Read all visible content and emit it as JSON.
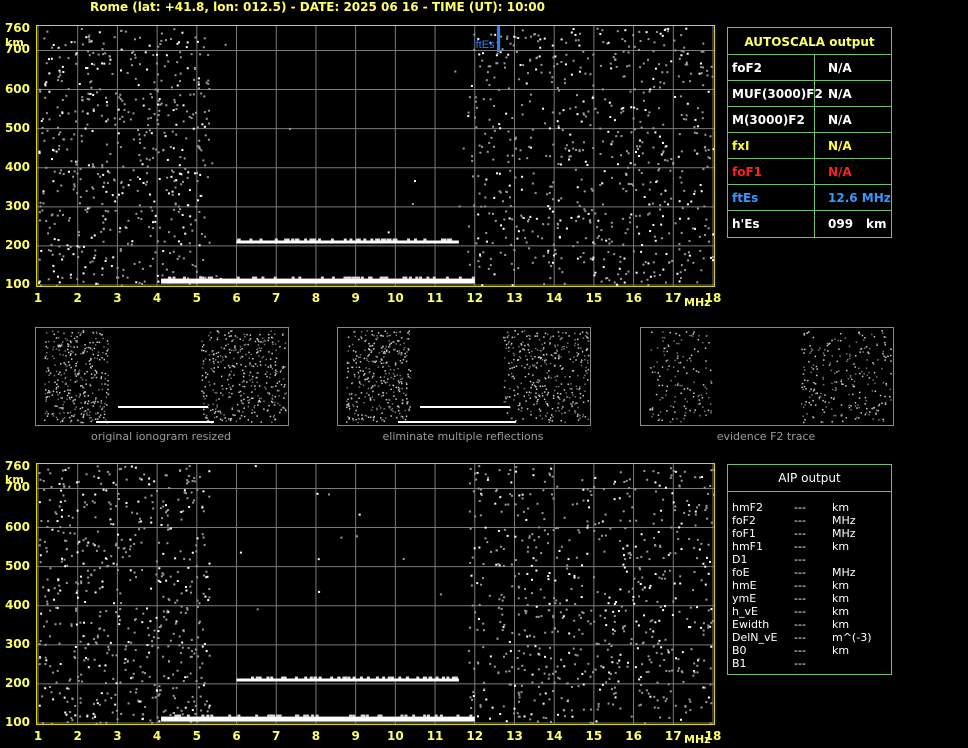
{
  "header": {
    "title": "Rome (lat: +41.8, lon: 012.5) - DATE: 2025 06 16 - TIME (UT): 10:00"
  },
  "axes": {
    "y_ticks": [
      "760",
      "700",
      "600",
      "500",
      "400",
      "300",
      "200",
      "100"
    ],
    "y_unit": "km",
    "x_ticks": [
      "1",
      "2",
      "3",
      "4",
      "5",
      "6",
      "7",
      "8",
      "9",
      "10",
      "11",
      "12",
      "13",
      "14",
      "15",
      "16",
      "17",
      "18"
    ],
    "x_unit": "MHz"
  },
  "plot_top": {
    "marker_label": "ftEs"
  },
  "chart_data": [
    {
      "type": "scatter",
      "name": "top-ionogram",
      "x_range": [
        1,
        18
      ],
      "y_range": [
        100,
        760
      ],
      "grid": true,
      "traces": [
        {
          "name": "E-layer trace",
          "x_start": 4.1,
          "x_end": 12.0,
          "y": 110
        },
        {
          "name": "Es-second-hop",
          "x_start": 6.0,
          "x_end": 11.6,
          "y": 210
        }
      ],
      "marker": {
        "label": "ftEs",
        "x": 12.6
      }
    },
    {
      "type": "scatter",
      "name": "bottom-ionogram",
      "x_range": [
        1,
        18
      ],
      "y_range": [
        100,
        760
      ],
      "grid": true,
      "traces": [
        {
          "name": "E-layer trace",
          "x_start": 4.1,
          "x_end": 12.0,
          "y": 110
        },
        {
          "name": "Es-second-hop",
          "x_start": 6.0,
          "x_end": 11.6,
          "y": 210
        }
      ]
    }
  ],
  "autoscala": {
    "title": "AUTOSCALA output",
    "rows": [
      {
        "key": "foF2",
        "value": "N/A",
        "color": "#ffffff"
      },
      {
        "key": "MUF(3000)F2",
        "value": "N/A",
        "color": "#ffffff"
      },
      {
        "key": "M(3000)F2",
        "value": "N/A",
        "color": "#ffffff"
      },
      {
        "key": "fxI",
        "value": "N/A",
        "color": "#ffff33"
      },
      {
        "key": "foF1",
        "value": "N/A",
        "color": "#ff2020"
      },
      {
        "key": "ftEs",
        "value": "12.6 MHz",
        "color": "#3399ff"
      },
      {
        "key": "h'Es",
        "value": "099",
        "unit": "km",
        "color": "#ffffff"
      }
    ]
  },
  "thumbnails": [
    {
      "caption": "original ionogram resized"
    },
    {
      "caption": "eliminate multiple reflections"
    },
    {
      "caption": "evidence F2 trace"
    }
  ],
  "aip": {
    "title": "AIP output",
    "rows": [
      {
        "key": "hmF2",
        "value": "---",
        "unit": "km"
      },
      {
        "key": "foF2",
        "value": "---",
        "unit": "MHz"
      },
      {
        "key": "foF1",
        "value": "---",
        "unit": "MHz"
      },
      {
        "key": "hmF1",
        "value": "---",
        "unit": "km"
      },
      {
        "key": "D1",
        "value": "---",
        "unit": ""
      },
      {
        "key": "foE",
        "value": "---",
        "unit": "MHz"
      },
      {
        "key": "hmE",
        "value": "---",
        "unit": "km"
      },
      {
        "key": "ymE",
        "value": "---",
        "unit": "km"
      },
      {
        "key": "h_vE",
        "value": "---",
        "unit": "km"
      },
      {
        "key": "Ewidth",
        "value": "---",
        "unit": "km"
      },
      {
        "key": "DelN_vE",
        "value": "---",
        "unit": "m^(-3)"
      },
      {
        "key": "B0",
        "value": "---",
        "unit": "km"
      },
      {
        "key": "B1",
        "value": "---",
        "unit": ""
      }
    ]
  }
}
